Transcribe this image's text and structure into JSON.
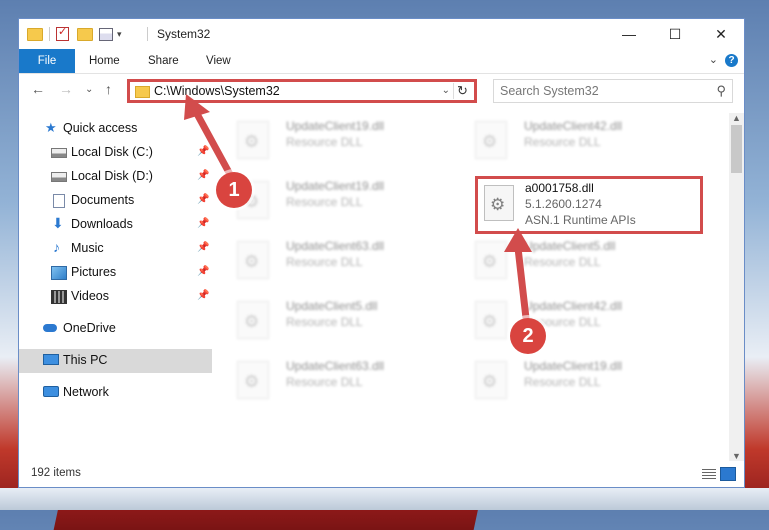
{
  "window": {
    "title": "System32",
    "controls": {
      "minimize": "—",
      "maximize": "☐",
      "close": "✕"
    }
  },
  "ribbon": {
    "file_tab": "File",
    "tabs": [
      "Home",
      "Share",
      "View"
    ],
    "help": "?"
  },
  "address_bar": {
    "path": "C:\\Windows\\System32"
  },
  "search": {
    "placeholder": "Search System32"
  },
  "sidebar": {
    "items": [
      {
        "label": "Quick access",
        "icon": "star-icon",
        "pinned": false
      },
      {
        "label": "Local Disk (C:)",
        "icon": "drive-icon",
        "pinned": true
      },
      {
        "label": "Local Disk (D:)",
        "icon": "drive-icon",
        "pinned": true
      },
      {
        "label": "Documents",
        "icon": "documents-icon",
        "pinned": true
      },
      {
        "label": "Downloads",
        "icon": "downloads-icon",
        "pinned": true
      },
      {
        "label": "Music",
        "icon": "music-icon",
        "pinned": true
      },
      {
        "label": "Pictures",
        "icon": "pictures-icon",
        "pinned": true
      },
      {
        "label": "Videos",
        "icon": "videos-icon",
        "pinned": true
      },
      {
        "label": "OneDrive",
        "icon": "onedrive-icon",
        "pinned": false
      },
      {
        "label": "This PC",
        "icon": "this-pc-icon",
        "pinned": false,
        "selected": true
      },
      {
        "label": "Network",
        "icon": "network-icon",
        "pinned": false
      }
    ]
  },
  "files": {
    "left_column": [
      {
        "name": "UpdateClient19.dll",
        "desc": "Resource DLL"
      },
      {
        "name": "UpdateClient19.dll",
        "desc": "Resource DLL"
      },
      {
        "name": "UpdateClient63.dll",
        "desc": "Resource DLL"
      },
      {
        "name": "UpdateClient5.dll",
        "desc": "Resource DLL"
      },
      {
        "name": "UpdateClient63.dll",
        "desc": "Resource DLL"
      }
    ],
    "right_column": [
      {
        "name": "UpdateClient42.dll",
        "desc": "Resource DLL"
      },
      {
        "name": "UpdateClient5.dll",
        "desc": "Resource DLL"
      },
      {
        "name": "UpdateClient42.dll",
        "desc": "Resource DLL"
      },
      {
        "name": "UpdateClient19.dll",
        "desc": "Resource DLL"
      }
    ],
    "highlighted": {
      "name": "a0001758.dll",
      "version": "5.1.2600.1274",
      "description": "ASN.1 Runtime APIs"
    }
  },
  "status": {
    "item_count": "192 items"
  },
  "annotations": {
    "step1": "1",
    "step2": "2",
    "color": "#d24c4c"
  }
}
